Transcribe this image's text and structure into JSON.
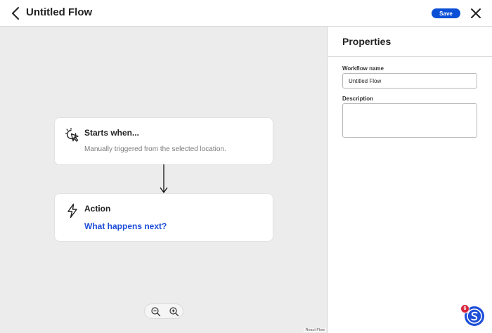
{
  "header": {
    "title": "Untitled Flow",
    "save_label": "Save"
  },
  "canvas": {
    "nodes": [
      {
        "title": "Starts when...",
        "subtitle": "Manually triggered from the selected location.",
        "icon": "cursor-click-icon"
      },
      {
        "title": "Action",
        "link": "What happens next?",
        "icon": "lightning-icon"
      }
    ],
    "attribution": "React Flow"
  },
  "panel": {
    "title": "Properties",
    "name_label": "Workflow name",
    "name_value": "Untitled Flow",
    "description_label": "Description",
    "description_value": ""
  },
  "help": {
    "badge_count": "6",
    "icon": "brand-s-icon"
  },
  "colors": {
    "accent": "#0b4fd6",
    "link": "#1d4ed8",
    "canvas_bg": "#ececec",
    "badge": "#d7263d"
  }
}
